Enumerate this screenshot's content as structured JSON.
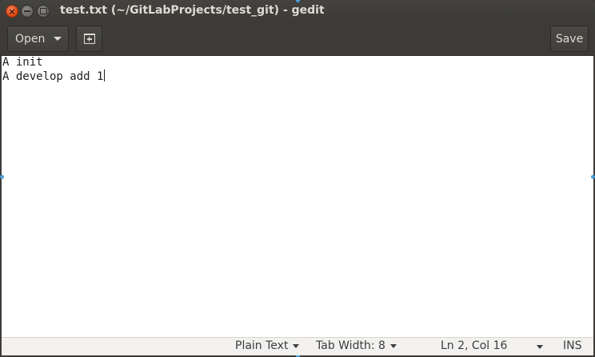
{
  "window": {
    "title": "test.txt (~/GitLabProjects/test_git) - gedit"
  },
  "toolbar": {
    "open_label": "Open",
    "save_label": "Save"
  },
  "editor": {
    "lines": [
      "A init",
      "A develop add 1"
    ]
  },
  "statusbar": {
    "language": "Plain Text",
    "tab_width": "Tab Width: 8",
    "position": "Ln 2, Col 16",
    "mode": "INS"
  },
  "icons": {
    "close": "close-icon",
    "minimize": "minimize-icon",
    "maximize": "maximize-icon",
    "new_tab": "new-tab-icon",
    "dropdown": "chevron-down-icon"
  },
  "colors": {
    "titlebar": "#3c3b37",
    "close_button": "#df4a16",
    "editor_bg": "#ffffff",
    "statusbar_bg": "#f2f1f0"
  }
}
